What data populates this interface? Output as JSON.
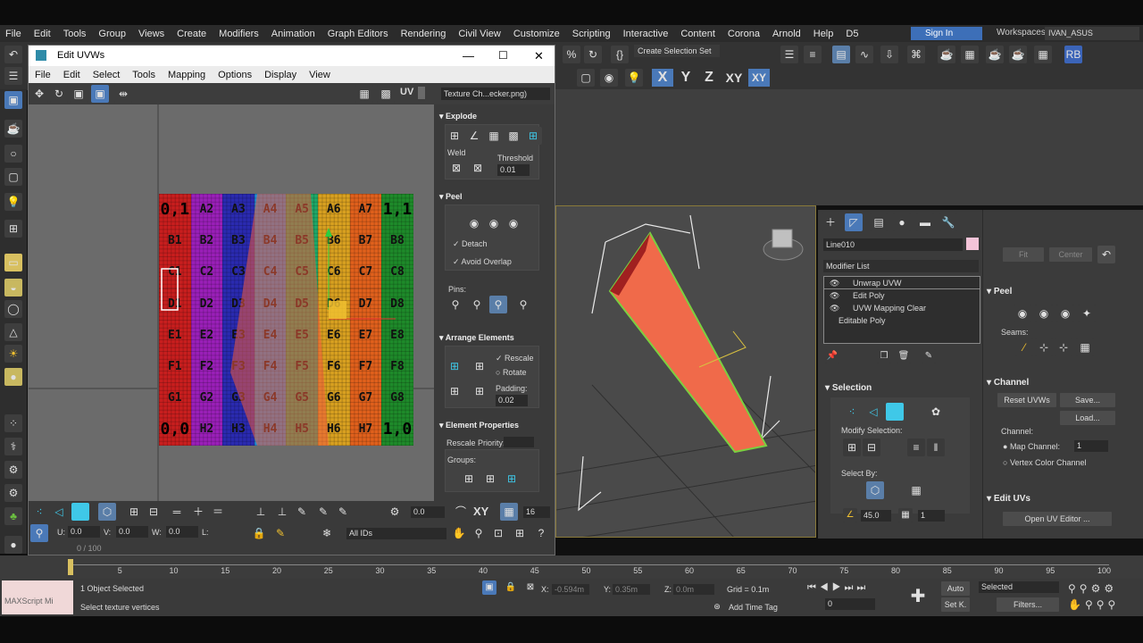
{
  "menubar": {
    "items": [
      "File",
      "Edit",
      "Tools",
      "Group",
      "Views",
      "Create",
      "Modifiers",
      "Animation",
      "Graph Editors",
      "Rendering",
      "Civil View",
      "Customize",
      "Scripting",
      "Interactive",
      "Content",
      "Corona",
      "Arnold",
      "Help",
      "D5"
    ],
    "signin": "Sign In",
    "workspace_label": "Workspaces:",
    "workspace_value": "IVAN_ASUS"
  },
  "toolbar": {
    "create_selection_set": "Create Selection Set",
    "axis_x": "X",
    "axis_y": "Y",
    "axis_z": "Z",
    "axis_xy": "XY",
    "axis_xy2": "XY"
  },
  "uvw": {
    "title": "Edit UVWs",
    "menu": [
      "File",
      "Edit",
      "Select",
      "Tools",
      "Mapping",
      "Options",
      "Display",
      "View"
    ],
    "uv_label": "UV",
    "texture_select": "Texture Ch...ecker.png)",
    "checker_rows": [
      [
        "0,1",
        "A2",
        "A3",
        "A4",
        "A5",
        "A6",
        "A7",
        "1,1"
      ],
      [
        "B1",
        "B2",
        "B3",
        "B4",
        "B5",
        "B6",
        "B7",
        "B8"
      ],
      [
        "C1",
        "C2",
        "C3",
        "C4",
        "C5",
        "C6",
        "C7",
        "C8"
      ],
      [
        "D1",
        "D2",
        "D3",
        "D4",
        "D5",
        "D6",
        "D7",
        "D8"
      ],
      [
        "E1",
        "E2",
        "E3",
        "E4",
        "E5",
        "E6",
        "E7",
        "E8"
      ],
      [
        "F1",
        "F2",
        "F3",
        "F4",
        "F5",
        "F6",
        "F7",
        "F8"
      ],
      [
        "G1",
        "G2",
        "G3",
        "G4",
        "G5",
        "G6",
        "G7",
        "G8"
      ],
      [
        "0,0",
        "H2",
        "H3",
        "H4",
        "H5",
        "H6",
        "H7",
        "1,0"
      ]
    ],
    "column_colors": [
      "#c81e1e",
      "#9a1fb8",
      "#2a2ab0",
      "#1e8fd8",
      "#1ea868",
      "#d8a020",
      "#e0601c",
      "#1e8a2a"
    ],
    "explode": {
      "header": "Explode",
      "weld": "Weld",
      "threshold_label": "Threshold",
      "threshold": "0.01"
    },
    "peel": {
      "header": "Peel",
      "detach": "Detach",
      "avoid_overlap": "Avoid Overlap",
      "pins": "Pins:"
    },
    "arrange": {
      "header": "Arrange Elements",
      "rescale": "Rescale",
      "rotate": "Rotate",
      "padding_label": "Padding:",
      "padding": "0.02"
    },
    "element_props": {
      "header": "Element Properties",
      "rescale_priority": "Rescale Priority:",
      "groups": "Groups:"
    },
    "bottom": {
      "spin_value": "0.0",
      "xy": "XY",
      "grid_value": "16",
      "u_label": "U:",
      "u_value": "0.0",
      "v_label": "V:",
      "v_value": "0.0",
      "w_label": "W:",
      "w_value": "0.0",
      "l_label": "L:",
      "ids": "All IDs",
      "progress": "0 / 100"
    }
  },
  "command_panel": {
    "object_name": "Line010",
    "modifier_list": "Modifier List",
    "stack": [
      "Unwrap UVW",
      "Edit Poly",
      "UVW Mapping Clear",
      "Editable Poly"
    ],
    "selection": {
      "header": "Selection",
      "modify_selection": "Modify Selection:",
      "select_by": "Select By:",
      "angle": "45.0",
      "count": "1"
    }
  },
  "right_panel": {
    "fit": "Fit",
    "center": "Center",
    "peel_header": "Peel",
    "seams": "Seams:",
    "channel_header": "Channel",
    "reset_uvws": "Reset UVWs",
    "save": "Save...",
    "load": "Load...",
    "channel_label": "Channel:",
    "map_channel": "Map Channel:",
    "map_channel_value": "1",
    "vertex_color_channel": "Vertex Color Channel",
    "edit_uvs_header": "Edit UVs",
    "open_uv_editor": "Open UV Editor ..."
  },
  "timeline": {
    "ticks": [
      "5",
      "10",
      "15",
      "20",
      "25",
      "30",
      "35",
      "40",
      "45",
      "50",
      "55",
      "60",
      "65",
      "70",
      "75",
      "80",
      "85",
      "90",
      "95",
      "100"
    ]
  },
  "status": {
    "maxscript": "MAXScript Mi",
    "objects_selected": "1 Object Selected",
    "prompt": "Select texture vertices",
    "x_label": "X:",
    "x_value": "-0.594m",
    "y_label": "Y:",
    "y_value": "0.35m",
    "z_label": "Z:",
    "z_value": "0.0m",
    "grid": "Grid = 0.1m",
    "add_time_tag": "Add Time Tag",
    "auto": "Auto",
    "selected": "Selected",
    "set_k": "Set K.",
    "filters": "Filters...",
    "frame": "0"
  }
}
